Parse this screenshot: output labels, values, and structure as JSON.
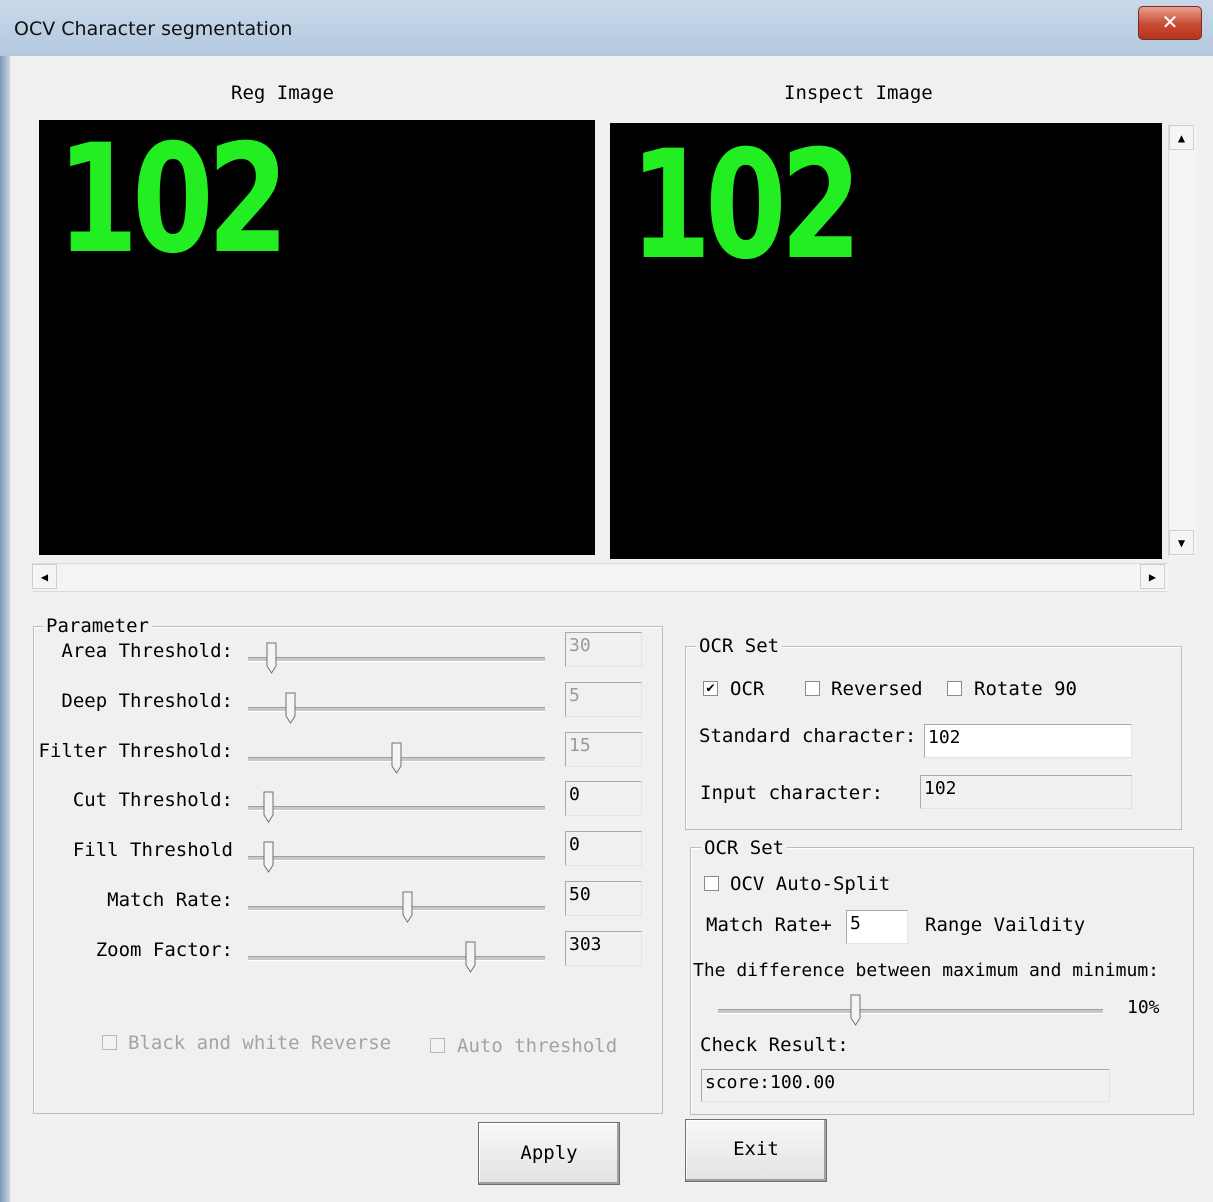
{
  "window": {
    "title": "OCV Character segmentation",
    "close_symbol": "✕"
  },
  "images": {
    "reg_label": "Reg Image",
    "inspect_label": "Inspect Image",
    "reg_text": "102",
    "inspect_text": "102"
  },
  "scroll": {
    "up": "▲",
    "down": "▼",
    "left": "◀",
    "right": "▶"
  },
  "parameter": {
    "title": "Parameter",
    "rows": [
      {
        "label": "Area Threshold:",
        "value": "30",
        "level": 0.05
      },
      {
        "label": "Deep Threshold:",
        "value": "5",
        "level": 0.12
      },
      {
        "label": "Filter Threshold:",
        "value": "15",
        "level": 0.5
      },
      {
        "label": "Cut Threshold:",
        "value": "0",
        "level": 0.04
      },
      {
        "label": "Fill Threshold",
        "value": "0",
        "level": 0.04
      },
      {
        "label": "Match Rate:",
        "value": "50",
        "level": 0.54
      },
      {
        "label": "Zoom Factor:",
        "value": "303",
        "level": 0.77
      }
    ],
    "bw_reverse": "Black and white Reverse",
    "auto_threshold": "Auto threshold"
  },
  "ocr_set": {
    "title": "OCR Set",
    "ocr_label": "OCR",
    "ocr_checked": "✔",
    "reversed_label": "Reversed",
    "rotate_label": "Rotate 90",
    "standard_label": "Standard character:",
    "standard_value": "102",
    "input_label": "Input character:",
    "input_value": "102"
  },
  "ocv_set": {
    "title": "OCR Set",
    "auto_split_label": "OCV Auto-Split",
    "match_rate_label": "Match Rate+",
    "match_rate_value": "5",
    "range_label": "Range Vaildity",
    "difference_label": "The difference between maximum and minimum:",
    "difference_value": "10%",
    "difference_level": 0.35,
    "check_result_label": "Check Result:",
    "check_result_value": "score:100.00"
  },
  "buttons": {
    "apply": "Apply",
    "exit": "Exit"
  }
}
